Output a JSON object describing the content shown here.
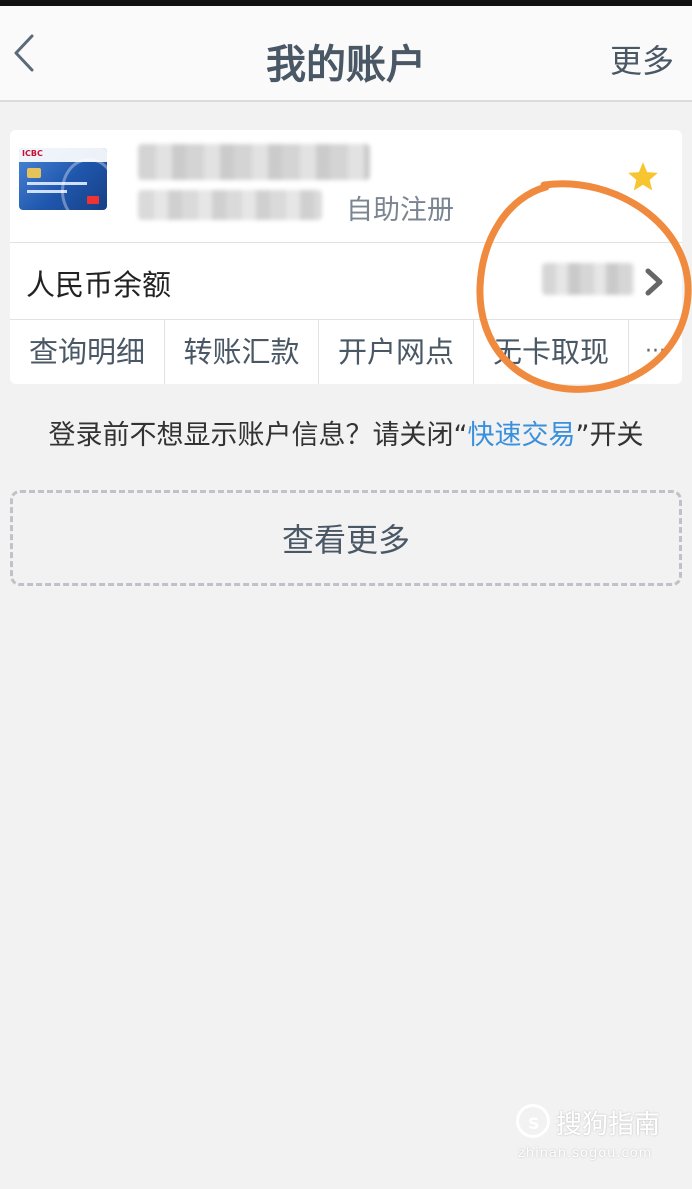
{
  "header": {
    "title": "我的账户",
    "more": "更多"
  },
  "account": {
    "register_label": "自助注册",
    "balance_label": "人民币余额",
    "card_logo_text": "ICBC",
    "actions": [
      "查询明细",
      "转账汇款",
      "开户网点",
      "无卡取现",
      "···"
    ]
  },
  "notice": {
    "prefix": "登录前不想显示账户信息？请关闭“",
    "link": "快速交易",
    "suffix": "”开关"
  },
  "view_more": "查看更多",
  "watermark": {
    "text": "搜狗指南",
    "url": "zhinan.sogou.com"
  },
  "colors": {
    "accent_link": "#3a90dc",
    "annotation": "#f08a3e",
    "star": "#f7c530"
  }
}
